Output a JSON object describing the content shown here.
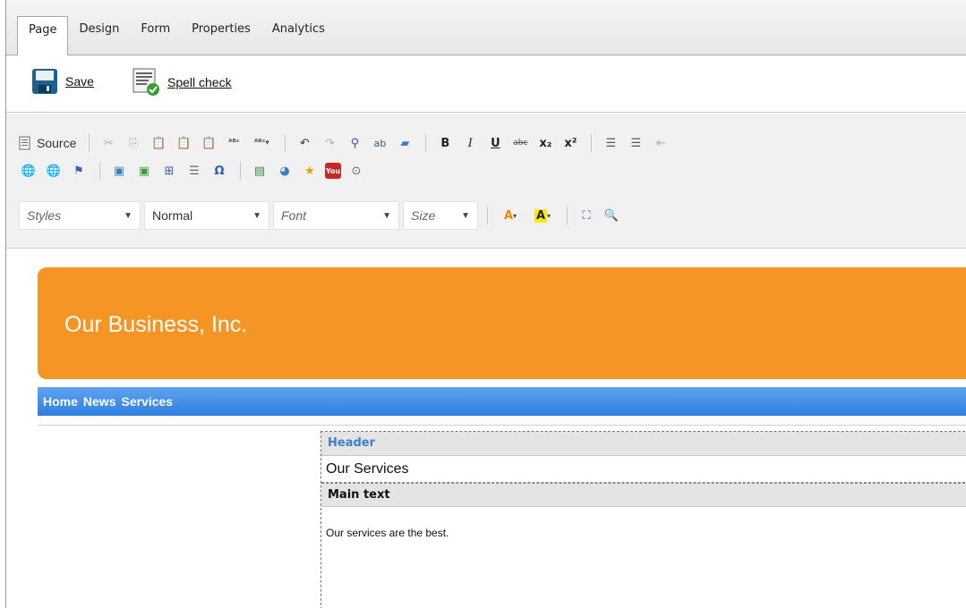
{
  "tabs": [
    "Page",
    "Design",
    "Form",
    "Properties",
    "Analytics"
  ],
  "actions": {
    "save_label": "Save",
    "spellcheck_label": "Spell check"
  },
  "toolbar": {
    "source_label": "Source",
    "styles_placeholder": "Styles",
    "format_value": "Normal",
    "font_placeholder": "Font",
    "size_placeholder": "Size"
  },
  "page": {
    "banner_title": "Our Business, Inc.",
    "nav_links": [
      "Home",
      "News",
      "Services"
    ],
    "header_label": "Header",
    "header_value": "Our Services",
    "maintext_label": "Main text",
    "maintext_value": "Our services are the best."
  },
  "colors": {
    "banner": "#f49525",
    "nav": "#2e7fe0",
    "header_label": "#3f7fcf"
  },
  "icons": {
    "row1": [
      "cut-icon",
      "copy-icon",
      "paste-icon",
      "paste-text-icon",
      "paste-word-icon",
      "spellcheck-icon",
      "spellcheck-menu-icon",
      "undo-icon",
      "redo-icon",
      "find-icon",
      "replace-icon",
      "eraser-icon",
      "bold-icon",
      "italic-icon",
      "underline-icon",
      "strikethrough-icon",
      "subscript-icon",
      "superscript-icon",
      "numbered-list-icon",
      "bulleted-list-icon"
    ],
    "row2": [
      "link-icon",
      "unlink-icon",
      "anchor-icon",
      "image-icon",
      "insert-image-icon",
      "table-icon",
      "horizontal-rule-icon",
      "special-char-icon",
      "template-icon",
      "chart-icon",
      "star-icon",
      "youtube-icon",
      "widget-icon"
    ],
    "row3": [
      "text-color-icon",
      "background-color-icon",
      "maximize-icon",
      "preview-icon"
    ]
  }
}
